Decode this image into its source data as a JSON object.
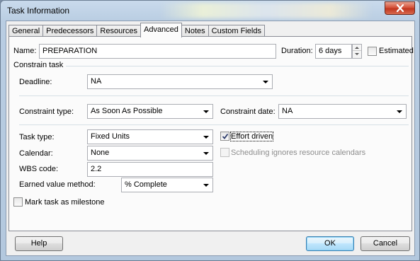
{
  "window": {
    "title": "Task Information",
    "close_icon": "close-x-icon",
    "close_color": "#c8412a"
  },
  "tabs": [
    {
      "label": "General"
    },
    {
      "label": "Predecessors"
    },
    {
      "label": "Resources"
    },
    {
      "label": "Advanced",
      "active": true
    },
    {
      "label": "Notes"
    },
    {
      "label": "Custom Fields"
    }
  ],
  "name": {
    "label": "Name:",
    "value": "PREPARATION"
  },
  "duration": {
    "label": "Duration:",
    "value": "6 days"
  },
  "estimated": {
    "label": "Estimated",
    "checked": false
  },
  "constrain_section": {
    "label": "Constrain task"
  },
  "deadline": {
    "label": "Deadline:",
    "value": "NA"
  },
  "constraint_type": {
    "label": "Constraint type:",
    "value": "As Soon As Possible"
  },
  "constraint_date": {
    "label": "Constraint date:",
    "value": "NA"
  },
  "task_type": {
    "label": "Task type:",
    "value": "Fixed Units"
  },
  "effort_driven": {
    "label": "Effort driven",
    "checked": true
  },
  "calendar": {
    "label": "Calendar:",
    "value": "None"
  },
  "scheduling_ignores": {
    "label": "Scheduling ignores resource calendars",
    "checked": false,
    "enabled": false
  },
  "wbs_code": {
    "label": "WBS code:",
    "value": "2.2"
  },
  "earned_value": {
    "label": "Earned value method:",
    "value": "% Complete"
  },
  "milestone": {
    "label": "Mark task as milestone",
    "checked": false
  },
  "buttons": {
    "help": "Help",
    "ok": "OK",
    "cancel": "Cancel"
  }
}
